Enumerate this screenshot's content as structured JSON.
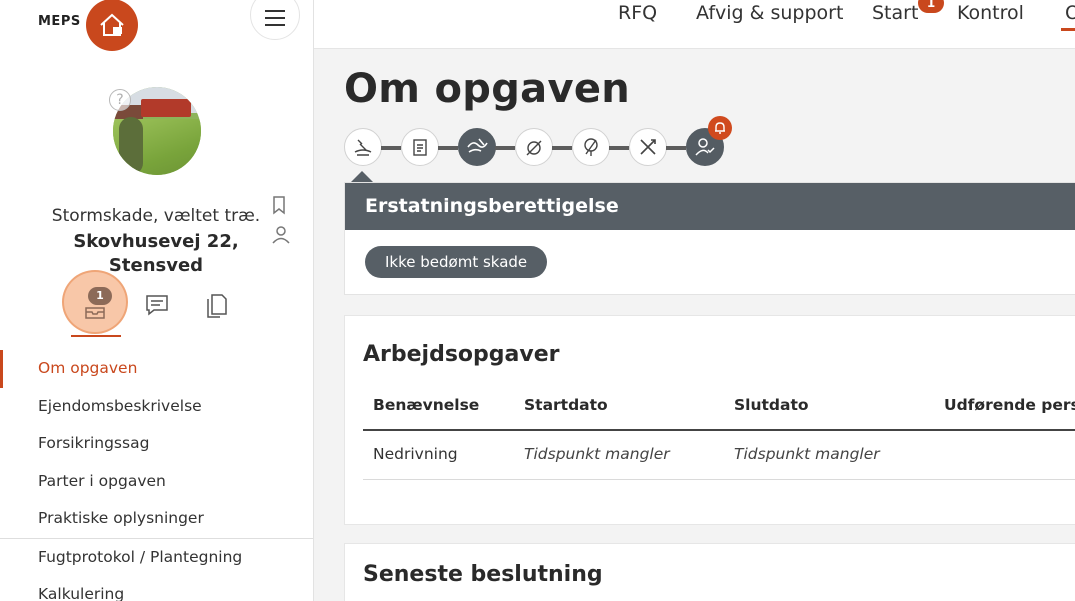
{
  "brand": {
    "name": "MEPS"
  },
  "colors": {
    "accent": "#c9481d",
    "dark": "#575f66"
  },
  "topnav": {
    "items": [
      "RFQ",
      "Afvig & support",
      "Start",
      "Kontrol",
      "O"
    ],
    "start_badge": "1"
  },
  "sidebar": {
    "help_glyph": "?",
    "description": "Stormskade, væltet træ.",
    "address_line1": "Skovhusevej 22,",
    "address_line2": "Stensved",
    "quick_badge": "1",
    "nav": [
      {
        "label": "Om opgaven",
        "active": true
      },
      {
        "label": "Ejendomsbeskrivelse"
      },
      {
        "label": "Forsikringssag"
      },
      {
        "label": "Parter i opgaven"
      },
      {
        "label": "Praktiske oplysninger"
      },
      {
        "label": "Fugtprotokol / Plantegning"
      },
      {
        "label": "Kalkulering"
      }
    ]
  },
  "main": {
    "title": "Om opgaven",
    "steps": [
      "people-hand-icon",
      "notes-icon",
      "storm-icon",
      "no-water-icon",
      "tree-bug-icon",
      "tools-icon",
      "person-check-icon"
    ],
    "eligibility": {
      "header": "Erstatningsberettigelse",
      "status": "Ikke bedømt skade"
    },
    "tasks": {
      "title": "Arbejdsopgaver",
      "columns": [
        "Benævnelse",
        "Startdato",
        "Slutdato",
        "Udførende person"
      ],
      "rows": [
        [
          "Nedrivning",
          "Tidspunkt mangler",
          "Tidspunkt mangler",
          ""
        ]
      ]
    },
    "latest_decision": {
      "title": "Seneste beslutning"
    }
  }
}
